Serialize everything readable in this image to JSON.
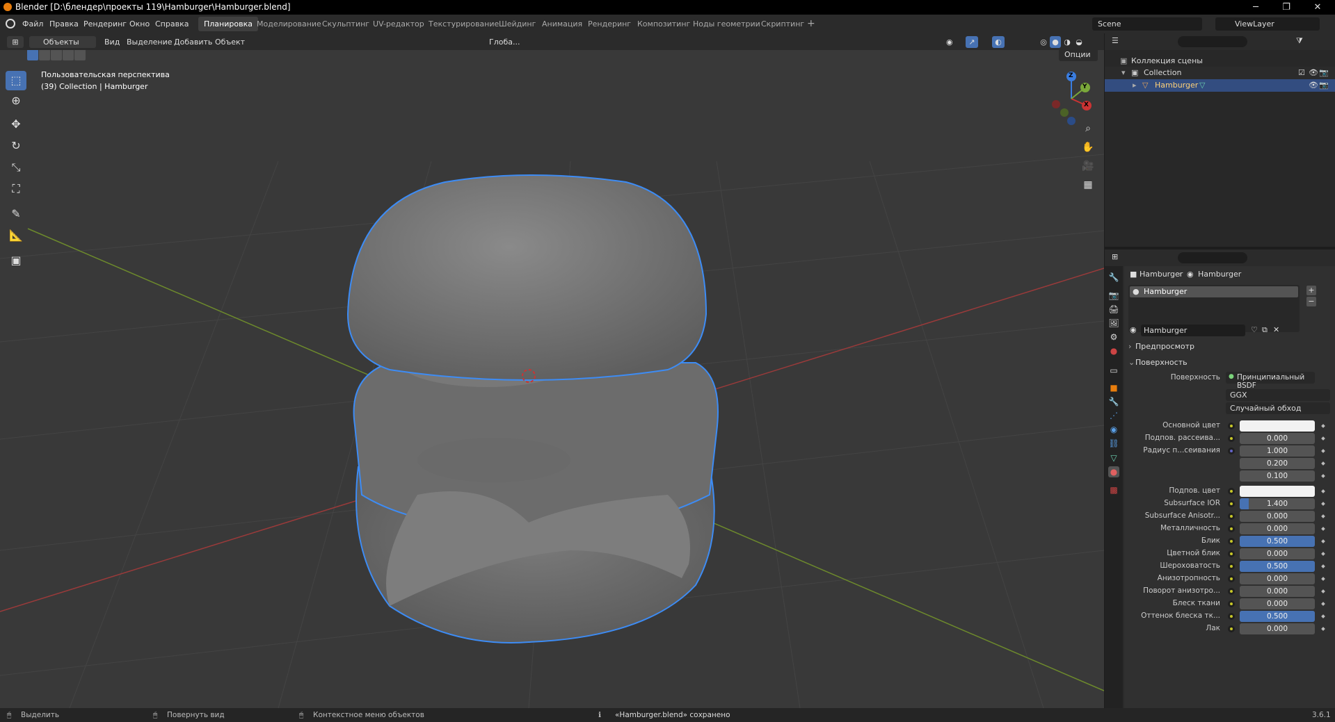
{
  "window": {
    "title": "Blender [D:\\блендер\\проекты 119\\Hamburger\\Hamburger.blend]",
    "min": "─",
    "max": "❐",
    "close": "✕"
  },
  "menu": [
    "Файл",
    "Правка",
    "Рендеринг",
    "Окно",
    "Справка"
  ],
  "workspaces": [
    {
      "label": "Планировка",
      "active": true
    },
    {
      "label": "Моделирование"
    },
    {
      "label": "Скульптинг"
    },
    {
      "label": "UV-редактор"
    },
    {
      "label": "Текстурирование"
    },
    {
      "label": "Шейдинг"
    },
    {
      "label": "Анимация"
    },
    {
      "label": "Рендеринг"
    },
    {
      "label": "Композитинг"
    },
    {
      "label": "Ноды геометрии"
    },
    {
      "label": "Скриптинг"
    }
  ],
  "workspace_add": "+",
  "scene": {
    "name": "Scene",
    "view_layer": "ViewLayer"
  },
  "viewport_header": {
    "mode": "Объекты",
    "menus": [
      "Вид",
      "Выделение",
      "Добавить",
      "Объект"
    ],
    "transform_orientation": "Глоба...",
    "options": "Опции"
  },
  "viewport": {
    "perspective_label": "Пользовательская перспектива",
    "collection_label": "(39) Collection | Hamburger",
    "gizmo": {
      "z": "Z",
      "y": "Y",
      "x": "X"
    }
  },
  "outliner": {
    "scene_collection": "Коллекция сцены",
    "collection": "Collection",
    "object": "Hamburger"
  },
  "properties": {
    "breadcrumb": [
      "Hamburger",
      "Hamburger"
    ],
    "material_slot": "Hamburger",
    "material_name": "Hamburger",
    "panel_preview": "Предпросмотр",
    "panel_surface": "Поверхность",
    "surface_label": "Поверхность",
    "surface_value": "Принципиальный BSDF",
    "distribution": "GGX",
    "subsurface_method": "Случайный обход",
    "rows": [
      {
        "label": "Основной цвет",
        "value": "",
        "color": "#f2f2f2"
      },
      {
        "label": "Подпов. рассеива...",
        "value": "0.000"
      },
      {
        "label": "Радиус п...сеивания",
        "value": "1.000",
        "dot": "blue"
      },
      {
        "label": "",
        "value": "0.200",
        "nodot": true
      },
      {
        "label": "",
        "value": "0.100",
        "nodot": true
      },
      {
        "label": "Подпов. цвет",
        "value": "",
        "color": "#f2f2f2"
      },
      {
        "label": "Subsurface IOR",
        "value": "1.400",
        "fill": 0.12
      },
      {
        "label": "Subsurface Anisotr...",
        "value": "0.000"
      },
      {
        "label": "Металличность",
        "value": "0.000"
      },
      {
        "label": "Блик",
        "value": "0.500",
        "fill": 1.0
      },
      {
        "label": "Цветной блик",
        "value": "0.000"
      },
      {
        "label": "Шероховатость",
        "value": "0.500",
        "fill": 1.0
      },
      {
        "label": "Анизотропность",
        "value": "0.000"
      },
      {
        "label": "Поворот анизотро...",
        "value": "0.000"
      },
      {
        "label": "Блеск ткани",
        "value": "0.000"
      },
      {
        "label": "Оттенок блеска тк...",
        "value": "0.500",
        "fill": 1.0
      },
      {
        "label": "Лак",
        "value": "0.000"
      }
    ]
  },
  "status": {
    "select": "Выделить",
    "rotate": "Повернуть вид",
    "context": "Контекстное меню объектов",
    "message": "«Hamburger.blend» сохранено",
    "version": "3.6.1"
  },
  "colors": {
    "accent": "#4772b3",
    "selection_outline": "#3d8cf5",
    "header": "#2b2b2b",
    "viewport": "#393939"
  }
}
